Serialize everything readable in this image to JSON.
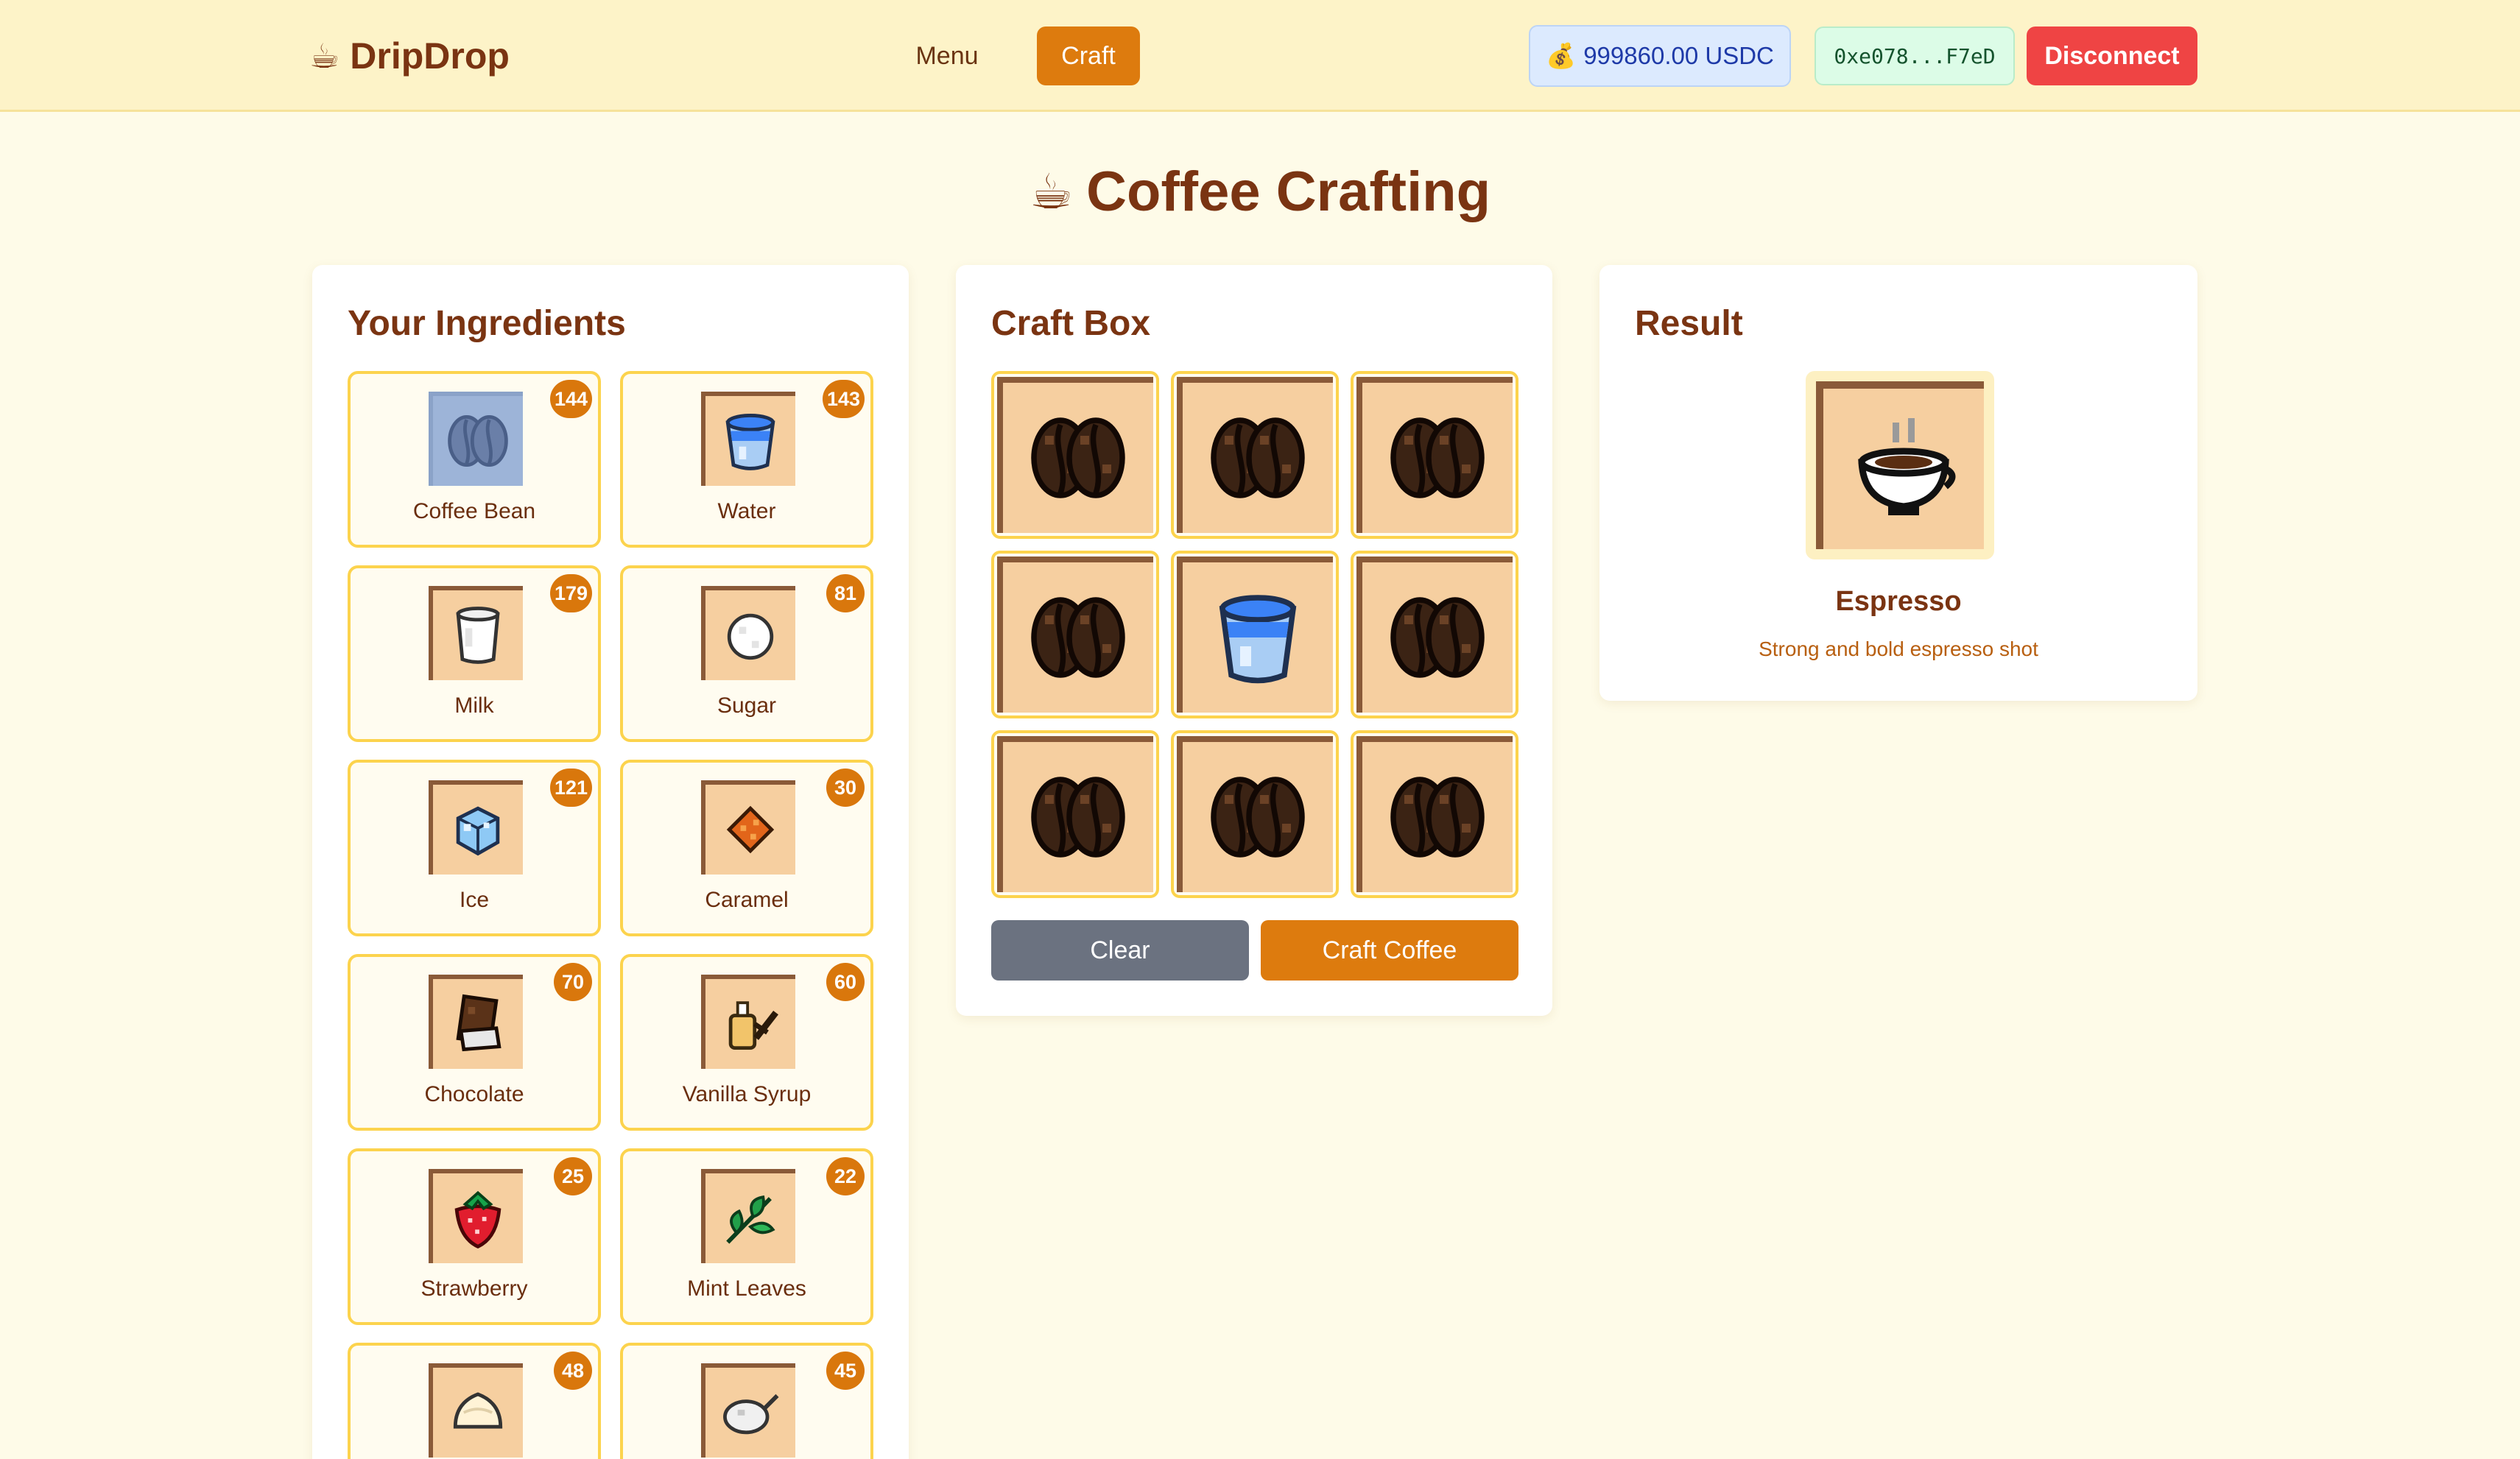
{
  "header": {
    "brand": "DripDrop",
    "brand_icon": "coffee-cup-icon",
    "nav": {
      "menu": "Menu",
      "craft": "Craft"
    },
    "balance": "999860.00 USDC",
    "balance_icon": "money-bag-icon",
    "wallet": "0xe078...F7eD",
    "disconnect": "Disconnect"
  },
  "page": {
    "title": "Coffee Crafting"
  },
  "ingredients": {
    "title": "Your Ingredients",
    "items": [
      {
        "name": "Coffee Bean",
        "count": "144",
        "icon": "coffee-bean-icon",
        "selected": true
      },
      {
        "name": "Water",
        "count": "143",
        "icon": "water-icon"
      },
      {
        "name": "Milk",
        "count": "179",
        "icon": "milk-icon"
      },
      {
        "name": "Sugar",
        "count": "81",
        "icon": "sugar-icon"
      },
      {
        "name": "Ice",
        "count": "121",
        "icon": "ice-icon"
      },
      {
        "name": "Caramel",
        "count": "30",
        "icon": "caramel-icon"
      },
      {
        "name": "Chocolate",
        "count": "70",
        "icon": "chocolate-icon"
      },
      {
        "name": "Vanilla Syrup",
        "count": "60",
        "icon": "vanilla-syrup-icon"
      },
      {
        "name": "Strawberry",
        "count": "25",
        "icon": "strawberry-icon"
      },
      {
        "name": "Mint Leaves",
        "count": "22",
        "icon": "mint-leaves-icon"
      },
      {
        "name": "",
        "count": "48",
        "icon": "whipped-cream-icon"
      },
      {
        "name": "",
        "count": "45",
        "icon": "tea-icon"
      }
    ]
  },
  "craft": {
    "title": "Craft Box",
    "slots": [
      "coffee-bean",
      "coffee-bean",
      "coffee-bean",
      "coffee-bean",
      "water",
      "coffee-bean",
      "coffee-bean",
      "coffee-bean",
      "coffee-bean"
    ],
    "clear": "Clear",
    "craft": "Craft Coffee"
  },
  "result": {
    "title": "Result",
    "name": "Espresso",
    "description": "Strong and bold espresso shot",
    "icon": "espresso-cup-icon"
  },
  "colors": {
    "accent": "#dd7b0e",
    "header_bg": "#fdf3c8",
    "page_bg": "#fefbe8",
    "danger": "#ef4444",
    "brown": "#7a3412"
  }
}
